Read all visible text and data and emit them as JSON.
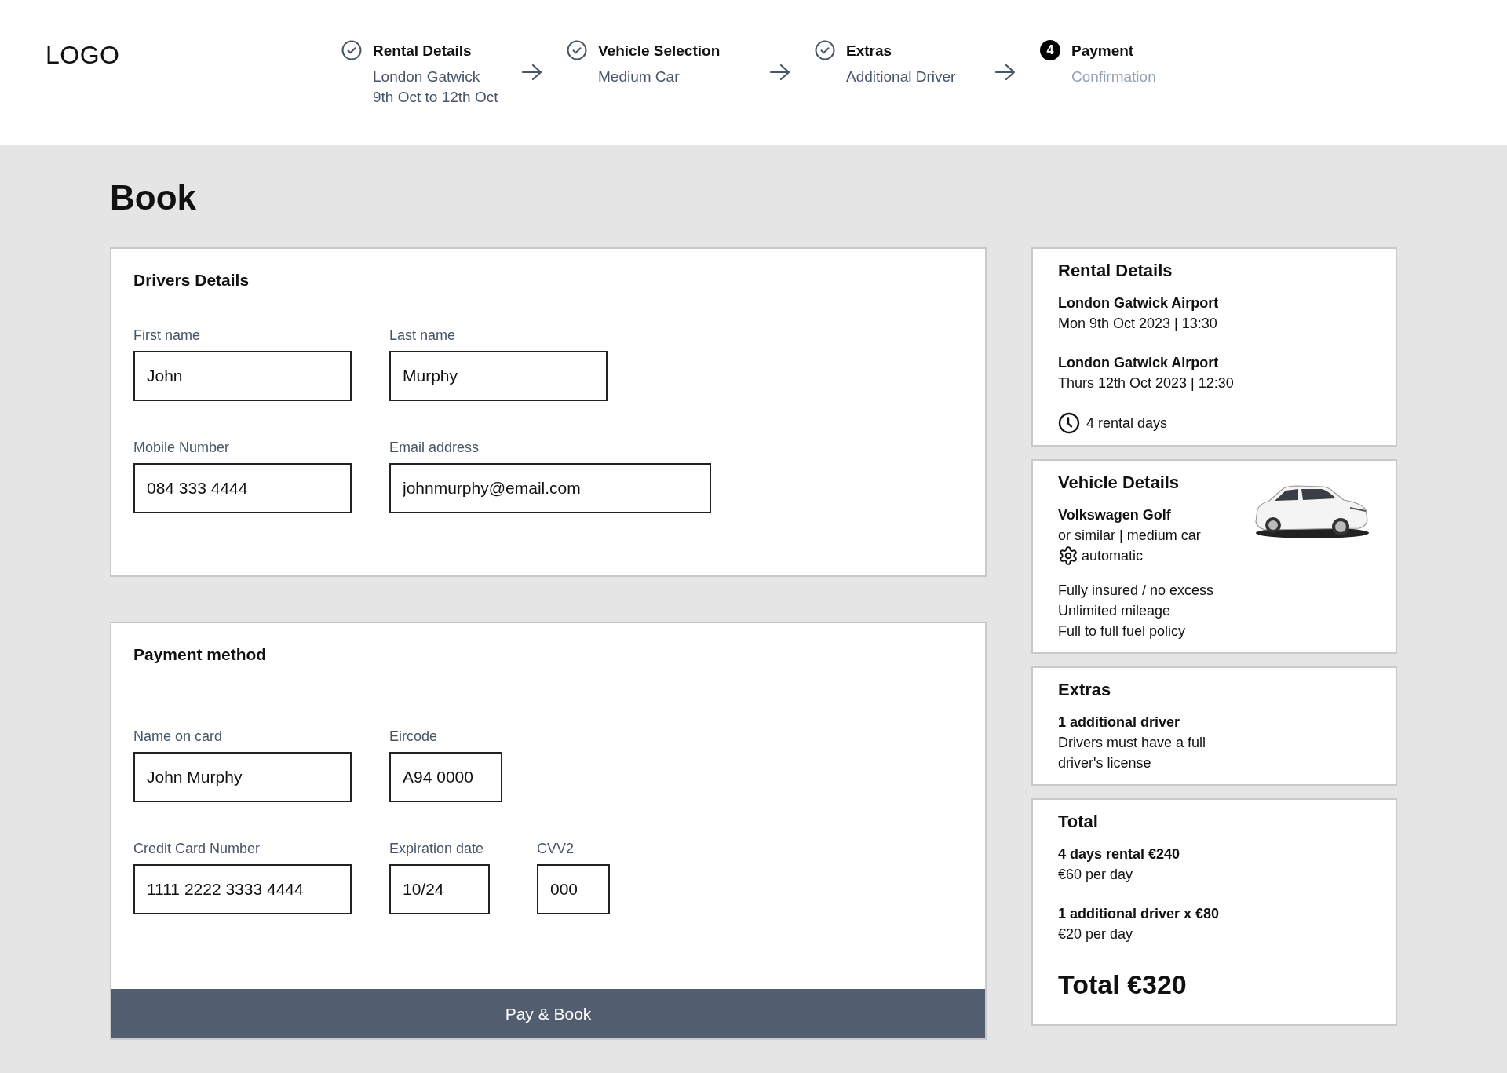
{
  "header": {
    "logo": "LOGO",
    "steps": [
      {
        "title": "Rental Details",
        "details": [
          "London Gatwick",
          "9th Oct to 12th Oct"
        ],
        "completed": true
      },
      {
        "title": "Vehicle Selection",
        "details": [
          "Medium Car"
        ],
        "completed": true
      },
      {
        "title": "Extras",
        "details": [
          "Additional Driver"
        ],
        "completed": true
      },
      {
        "title": "Payment",
        "details": [
          "Confirmation"
        ],
        "completed": false,
        "number": "4"
      }
    ]
  },
  "page_title": "Book",
  "drivers_details": {
    "title": "Drivers Details",
    "rows": [
      [
        {
          "label": "First name",
          "value": "John"
        },
        {
          "label": "Last name",
          "value": "Murphy"
        }
      ],
      [
        {
          "label": "Mobile Number",
          "value": "084 333 4444"
        },
        {
          "label": "Email address",
          "value": "johnmurphy@email.com"
        }
      ]
    ]
  },
  "payment_method": {
    "title": "Payment method",
    "rows": [
      [
        {
          "label": "Name on card",
          "value": "John Murphy"
        },
        {
          "label": "Eircode",
          "value": "A94 0000"
        }
      ],
      [
        {
          "label": "Credit Card Number",
          "value": "1111 2222 3333 4444"
        },
        {
          "label": "Expiration date",
          "value": "10/24"
        },
        {
          "label": "CVV2",
          "value": "000"
        }
      ]
    ],
    "button": "Pay & Book"
  },
  "rental_details": {
    "title": "Rental Details",
    "legs": [
      {
        "place": "London Gatwick Airport",
        "time": "Mon 9th Oct 2023 | 13:30"
      },
      {
        "place": "London Gatwick Airport",
        "time": "Thurs 12th Oct 2023 | 12:30"
      }
    ],
    "duration": "4 rental days"
  },
  "vehicle_details": {
    "title": "Vehicle Details",
    "model": "Volkswagen Golf",
    "category": "or similar | medium car",
    "transmission": "automatic",
    "features": [
      "Fully insured / no excess",
      "Unlimited mileage",
      "Full to full fuel policy"
    ]
  },
  "extras": {
    "title": "Extras",
    "items": [
      {
        "name": "1 additional driver",
        "note": "Drivers must have a full driver's license"
      }
    ]
  },
  "total": {
    "title": "Total",
    "lines": [
      {
        "label": "4 days rental €240",
        "note": "€60 per day"
      },
      {
        "label": "1 additional driver x €80",
        "note": "€20 per day"
      }
    ],
    "total": "Total €320"
  }
}
